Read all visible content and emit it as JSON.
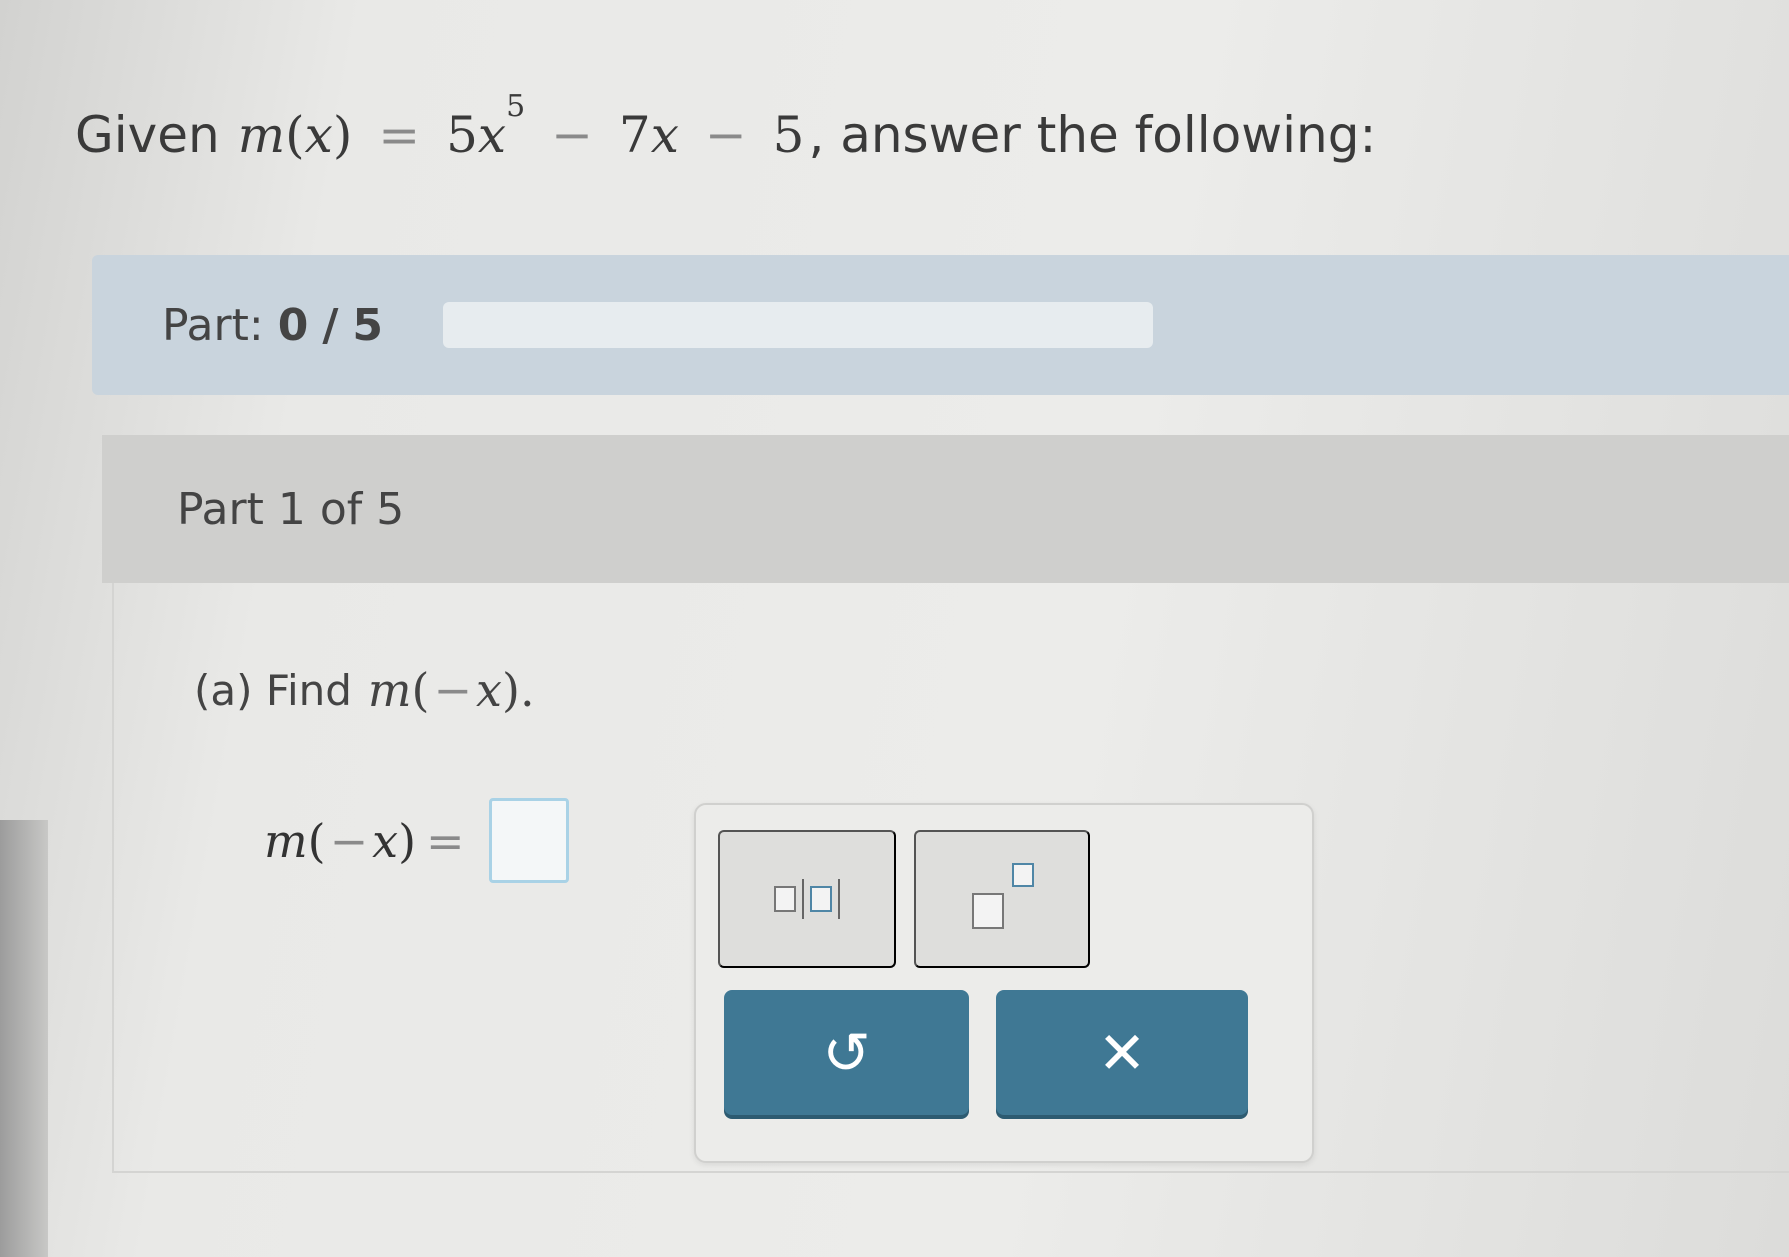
{
  "question": {
    "prefix": "Given",
    "fn": "m",
    "var": "x",
    "coef1": "5",
    "exp": "5",
    "op1": "−",
    "coef2": "7",
    "op2": "−",
    "const": "5",
    "suffix": ", answer the following:"
  },
  "progress": {
    "label": "Part:",
    "current": "0",
    "separator": "/",
    "total": "5",
    "fraction": 0
  },
  "part": {
    "title": "Part 1 of 5"
  },
  "prompt": {
    "label": "(a) Find",
    "expr_fn": "m",
    "expr_neg": "−",
    "expr_var": "x",
    "end": "."
  },
  "answer": {
    "fn": "m",
    "neg": "−",
    "var": "x",
    "eq": "=",
    "value": ""
  },
  "palette": {
    "tools": [
      {
        "name": "absolute-value-icon"
      },
      {
        "name": "exponent-icon"
      }
    ],
    "undo_icon": "↺",
    "clear_icon": "✕"
  },
  "colors": {
    "accent": "#3f7894",
    "progress_bg": "#c9d4dd",
    "panel_bg": "#cfcfcd",
    "input_border": "#a9d2e6"
  }
}
